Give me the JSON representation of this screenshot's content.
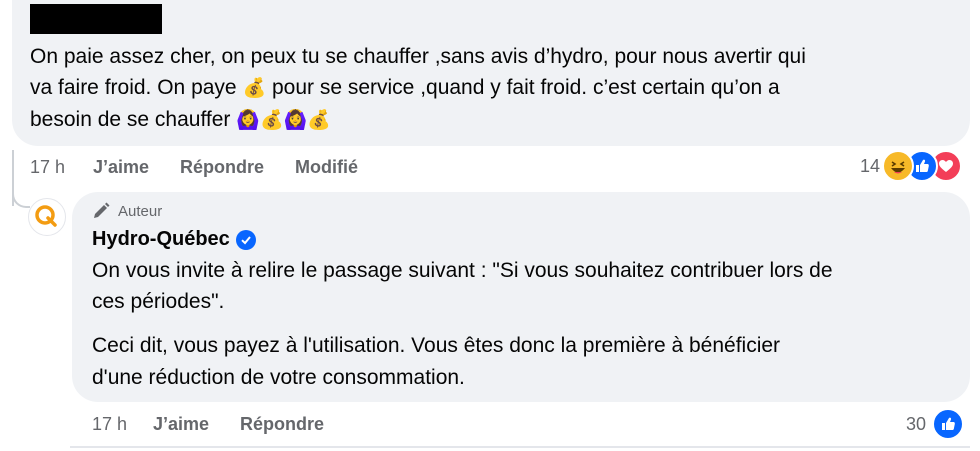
{
  "comment1": {
    "lines": [
      "On paie assez cher, on peux tu se chauffer ,sans avis d’hydro, pour nous avertir qui",
      "va faire froid. On paye",
      " pour se service ,quand y fait froid. c’est certain qu’on a",
      "besoin de se chauffer"
    ],
    "emoji_money": "💰",
    "emoji_person": "🙆‍♀️",
    "time": "17 h",
    "like": "J’aime",
    "reply": "Répondre",
    "edited": "Modifié",
    "reaction_count": "14",
    "reaction_icons": [
      "haha-icon",
      "like-icon",
      "love-icon"
    ]
  },
  "reply": {
    "badge": "Auteur",
    "name": "Hydro-Québec",
    "para1_lines": [
      "On vous invite à relire le passage suivant : \"Si vous souhaitez contribuer lors de",
      "ces périodes\"."
    ],
    "para2_lines": [
      "Ceci dit, vous payez à l'utilisation. Vous êtes donc la première à bénéficier",
      "d'une réduction de votre consommation."
    ],
    "time": "17 h",
    "like": "J’aime",
    "reply": "Répondre",
    "reaction_count": "30",
    "reaction_icons": [
      "like-icon"
    ]
  },
  "colors": {
    "bubble": "#f0f2f5",
    "meta_text": "#65676b",
    "like_blue": "#0866ff",
    "love_red": "#f33e58",
    "haha_yellow": "#f7b928",
    "hydro_orange": "#f39c12"
  }
}
